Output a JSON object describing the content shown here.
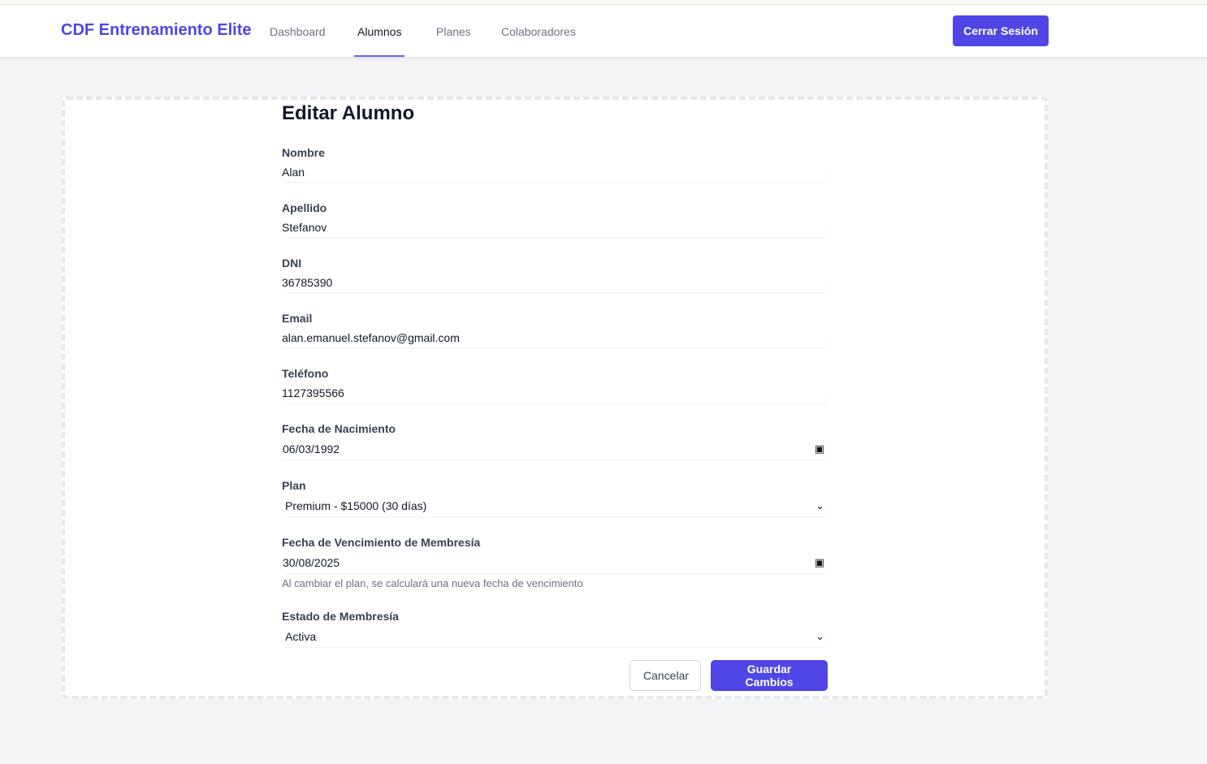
{
  "nav": {
    "brand": "CDF Entrenamiento Elite",
    "links": [
      "Dashboard",
      "Alumnos",
      "Planes",
      "Colaboradores"
    ],
    "active": "Alumnos",
    "logout": "Cerrar Sesión"
  },
  "form": {
    "title": "Editar Alumno",
    "nombre": {
      "label": "Nombre",
      "value": "Alan"
    },
    "apellido": {
      "label": "Apellido",
      "value": "Stefanov"
    },
    "dni": {
      "label": "DNI",
      "value": "36785390"
    },
    "email": {
      "label": "Email",
      "value": "alan.emanuel.stefanov@gmail.com"
    },
    "telefono": {
      "label": "Teléfono",
      "value": "1127395566"
    },
    "nacimiento": {
      "label": "Fecha de Nacimiento",
      "value": "06/03/1992"
    },
    "plan": {
      "label": "Plan",
      "value": "Premium - $15000 (30 días)"
    },
    "vencimiento": {
      "label": "Fecha de Vencimiento de Membresía",
      "value": "30/08/2025",
      "help": "Al cambiar el plan, se calculará una nueva fecha de vencimiento"
    },
    "estado": {
      "label": "Estado de Membresía",
      "value": "Activa"
    },
    "cancel": "Cancelar",
    "save": "Guardar Cambios"
  },
  "colors": {
    "accent": "#4f46e5",
    "background": "#f3f4f6"
  }
}
